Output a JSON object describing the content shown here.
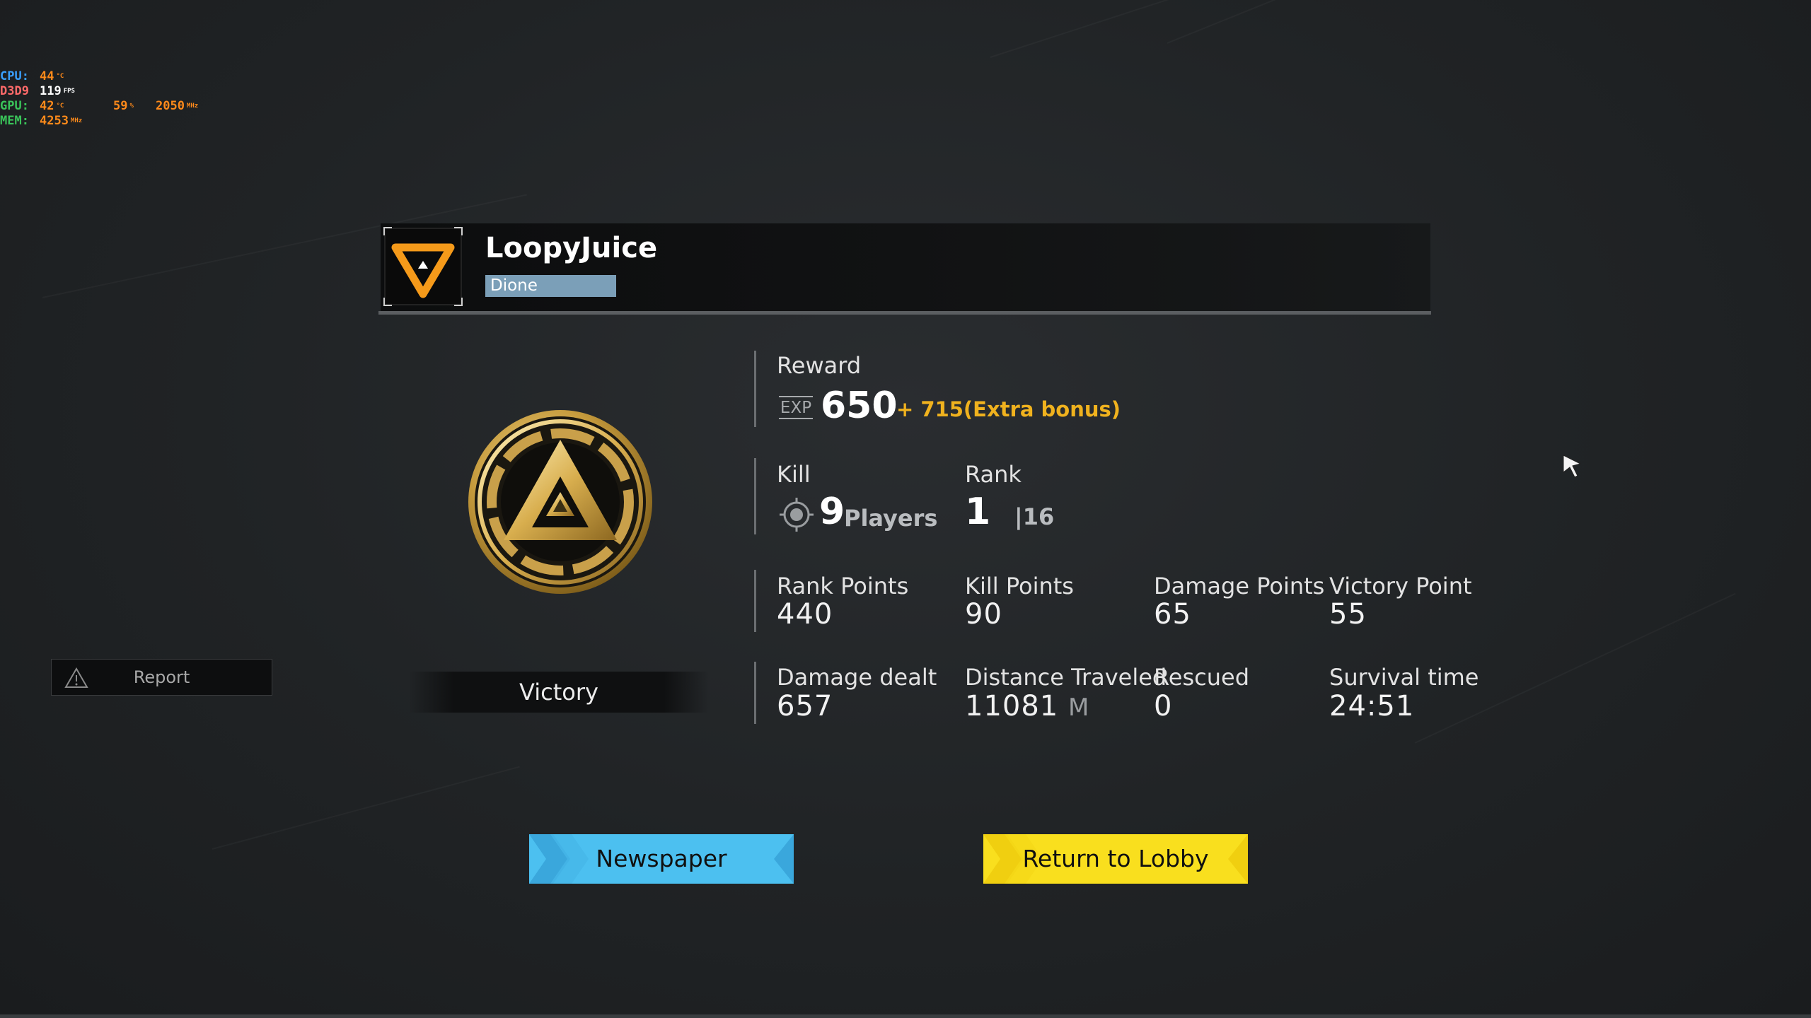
{
  "osd": {
    "rows": [
      {
        "label": "CPU:",
        "label_color": "#3aa0ff",
        "v1": "44",
        "u1": "°C"
      },
      {
        "label": "D3D9",
        "label_color": "#ff6a6a",
        "v1": "119",
        "u1": "FPS"
      },
      {
        "label": "GPU:",
        "label_color": "#3ac45a",
        "v1": "42",
        "u1": "°C",
        "v2": "59",
        "u2": "%",
        "v3": "2050",
        "u3": "MHz"
      },
      {
        "label": "MEM:",
        "label_color": "#3ac45a",
        "v1": "4253",
        "u1": "MHz"
      }
    ]
  },
  "player": {
    "name": "LoopyJuice",
    "server": "Dione"
  },
  "result": {
    "title": "Victory"
  },
  "report": {
    "label": "Report"
  },
  "reward": {
    "label": "Reward",
    "exp_tag": "EXP",
    "exp_value": "650",
    "bonus": "+ 715(Extra bonus)"
  },
  "kill": {
    "label": "Kill",
    "value": "9",
    "unit": "Players"
  },
  "rank": {
    "label": "Rank",
    "value": "1",
    "total": "|16"
  },
  "points": [
    {
      "label": "Rank Points",
      "value": "440"
    },
    {
      "label": "Kill Points",
      "value": "90"
    },
    {
      "label": "Damage Points",
      "value": "65"
    },
    {
      "label": "Victory Point",
      "value": "55"
    }
  ],
  "details": [
    {
      "label": "Damage dealt",
      "value": "657",
      "unit": ""
    },
    {
      "label": "Distance Traveled",
      "value": "11081",
      "unit": "M"
    },
    {
      "label": "Rescued",
      "value": "0",
      "unit": ""
    },
    {
      "label": "Survival time",
      "value": "24:51",
      "unit": ""
    }
  ],
  "buttons": {
    "newspaper": "Newspaper",
    "lobby": "Return to Lobby"
  },
  "colors": {
    "accent_gold": "#f0b21e",
    "emblem_orange": "#f59a1a",
    "server_badge": "#7b9fb8",
    "newspaper_button": "#4cc0f0",
    "lobby_button": "#f9df1e"
  },
  "icons": {
    "emblem": "triangle-emblem-icon",
    "medal": "gold-medal-icon",
    "report": "warning-icon",
    "kill": "crosshair-icon",
    "cursor": "mouse-cursor-icon"
  }
}
